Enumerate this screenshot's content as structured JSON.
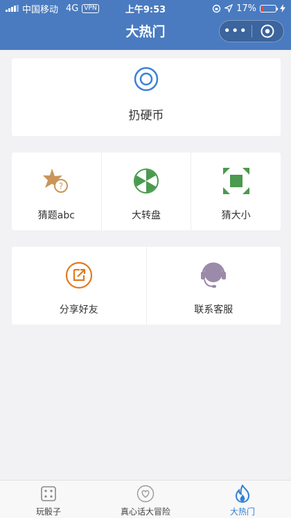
{
  "status_bar": {
    "carrier": "中国移动",
    "network": "4G",
    "vpn": "VPN",
    "time": "上午9:53",
    "battery": "17%",
    "battery_level": 0.17
  },
  "nav": {
    "title": "大热门",
    "more": "•••"
  },
  "feature": {
    "label": "扔硬币",
    "icon": "target-icon"
  },
  "grid1": [
    {
      "label": "猜题abc",
      "icon": "star-question-icon"
    },
    {
      "label": "大转盘",
      "icon": "wheel-icon"
    },
    {
      "label": "猜大小",
      "icon": "expand-icon"
    }
  ],
  "grid2": [
    {
      "label": "分享好友",
      "icon": "share-icon"
    },
    {
      "label": "联系客服",
      "icon": "headset-icon"
    }
  ],
  "tabs": [
    {
      "label": "玩骰子",
      "icon": "dice-icon"
    },
    {
      "label": "真心话大冒险",
      "icon": "heart-icon"
    },
    {
      "label": "大热门",
      "icon": "flame-icon",
      "active": true
    }
  ],
  "colors": {
    "brand": "#4a7bc0",
    "tab_active": "#2f7fd6",
    "wheel_green": "#4a9a4f",
    "star_brown": "#c9955a",
    "share_orange": "#e07a1f",
    "headset_purple": "#9b8aa9"
  }
}
